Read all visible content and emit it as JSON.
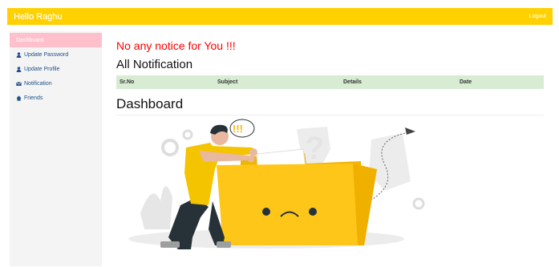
{
  "topbar": {
    "brand": "Hello Raghu",
    "logout_label": "Logout"
  },
  "sidebar": {
    "items": [
      {
        "label": "Dashboard",
        "icon": "none",
        "active": true
      },
      {
        "label": "Update Password",
        "icon": "user-icon"
      },
      {
        "label": "Update Profile",
        "icon": "user-icon"
      },
      {
        "label": "Notification",
        "icon": "envelope-icon"
      },
      {
        "label": "Friends",
        "icon": "home-icon"
      }
    ]
  },
  "main": {
    "notice": "No any notice for You !!!",
    "notifications_title": "All Notification",
    "table_headers": [
      "Sr.No",
      "Subject",
      "Details",
      "Date"
    ],
    "dashboard_title": "Dashboard",
    "illustration_text": "!!!"
  },
  "colors": {
    "topbar": "#ffd100",
    "sidebar_active": "#ffc0cb",
    "notice": "#ff0000",
    "table_header": "#d7ecd3",
    "link": "#1f4f8a"
  }
}
